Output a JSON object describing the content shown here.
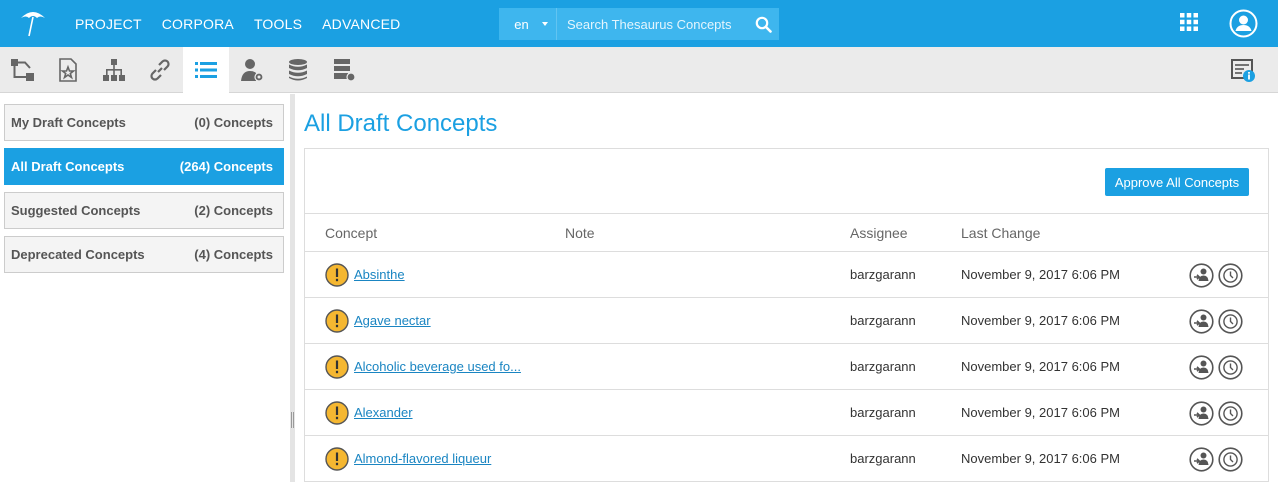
{
  "topbar": {
    "nav": [
      "PROJECT",
      "CORPORA",
      "TOOLS",
      "ADVANCED"
    ],
    "language": "en",
    "search_placeholder": "Search Thesaurus Concepts",
    "color": "#1ba0e2"
  },
  "toolbar": {
    "icons": [
      "hierarchy-tree-icon",
      "document-star-icon",
      "org-chart-icon",
      "link-icon",
      "list-icon",
      "user-settings-icon",
      "database-icon",
      "server-icon",
      "info-panel-icon"
    ],
    "active": "list-icon"
  },
  "sidebar": {
    "items": [
      {
        "label": "My Draft Concepts",
        "count": "(0) Concepts"
      },
      {
        "label": "All Draft Concepts",
        "count": "(264) Concepts"
      },
      {
        "label": "Suggested Concepts",
        "count": "(2) Concepts"
      },
      {
        "label": "Deprecated Concepts",
        "count": "(4) Concepts"
      }
    ],
    "active_index": 1
  },
  "main": {
    "title": "All Draft Concepts",
    "approve_label": "Approve All Concepts",
    "columns": [
      "Concept",
      "Note",
      "Assignee",
      "Last Change"
    ],
    "rows": [
      {
        "concept": "Absinthe",
        "note": "",
        "assignee": "barzgarann",
        "last_change": "November 9, 2017 6:06 PM"
      },
      {
        "concept": "Agave nectar",
        "note": "",
        "assignee": "barzgarann",
        "last_change": "November 9, 2017 6:06 PM"
      },
      {
        "concept": "Alcoholic beverage used fo...",
        "note": "",
        "assignee": "barzgarann",
        "last_change": "November 9, 2017 6:06 PM"
      },
      {
        "concept": "Alexander",
        "note": "",
        "assignee": "barzgarann",
        "last_change": "November 9, 2017 6:06 PM"
      },
      {
        "concept": "Almond-flavored liqueur",
        "note": "",
        "assignee": "barzgarann",
        "last_change": "November 9, 2017 6:06 PM"
      }
    ],
    "warning_color": "#f5b731"
  }
}
